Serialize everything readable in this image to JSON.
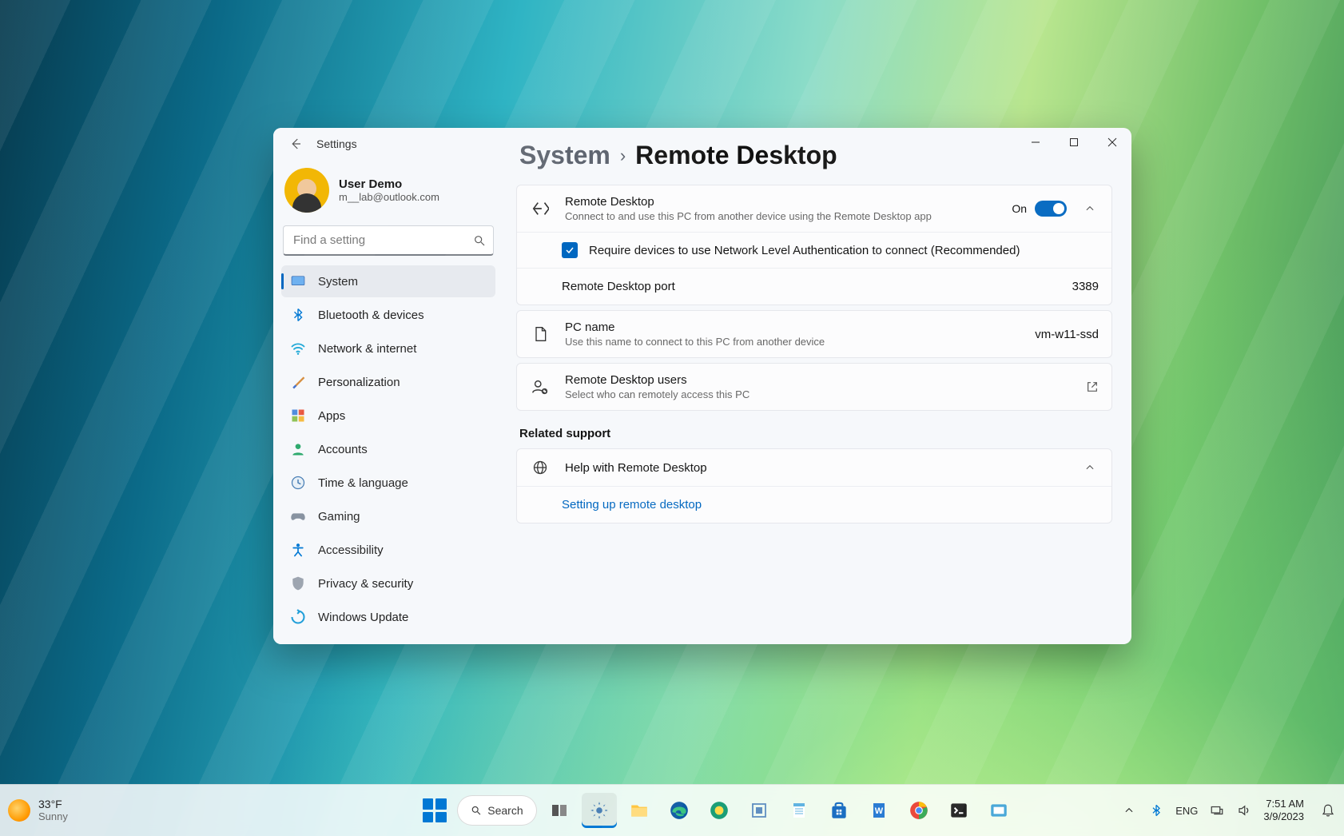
{
  "window": {
    "app_title": "Settings",
    "user": {
      "name": "User Demo",
      "email": "m__lab@outlook.com"
    },
    "search_placeholder": "Find a setting"
  },
  "sidebar": {
    "items": [
      {
        "label": "System",
        "active": true
      },
      {
        "label": "Bluetooth & devices"
      },
      {
        "label": "Network & internet"
      },
      {
        "label": "Personalization"
      },
      {
        "label": "Apps"
      },
      {
        "label": "Accounts"
      },
      {
        "label": "Time & language"
      },
      {
        "label": "Gaming"
      },
      {
        "label": "Accessibility"
      },
      {
        "label": "Privacy & security"
      },
      {
        "label": "Windows Update"
      }
    ]
  },
  "breadcrumb": {
    "parent": "System",
    "current": "Remote Desktop"
  },
  "remote_desktop": {
    "title": "Remote Desktop",
    "subtitle": "Connect to and use this PC from another device using the Remote Desktop app",
    "toggle_label": "On",
    "nla_label": "Require devices to use Network Level Authentication to connect (Recommended)",
    "port_label": "Remote Desktop port",
    "port_value": "3389"
  },
  "pc_name": {
    "title": "PC name",
    "subtitle": "Use this name to connect to this PC from another device",
    "value": "vm-w11-ssd"
  },
  "users": {
    "title": "Remote Desktop users",
    "subtitle": "Select who can remotely access this PC"
  },
  "related": {
    "heading": "Related support",
    "help_title": "Help with Remote Desktop",
    "link": "Setting up remote desktop"
  },
  "taskbar": {
    "weather_temp": "33°F",
    "weather_cond": "Sunny",
    "search_label": "Search",
    "lang": "ENG",
    "time": "7:51 AM",
    "date": "3/9/2023"
  }
}
